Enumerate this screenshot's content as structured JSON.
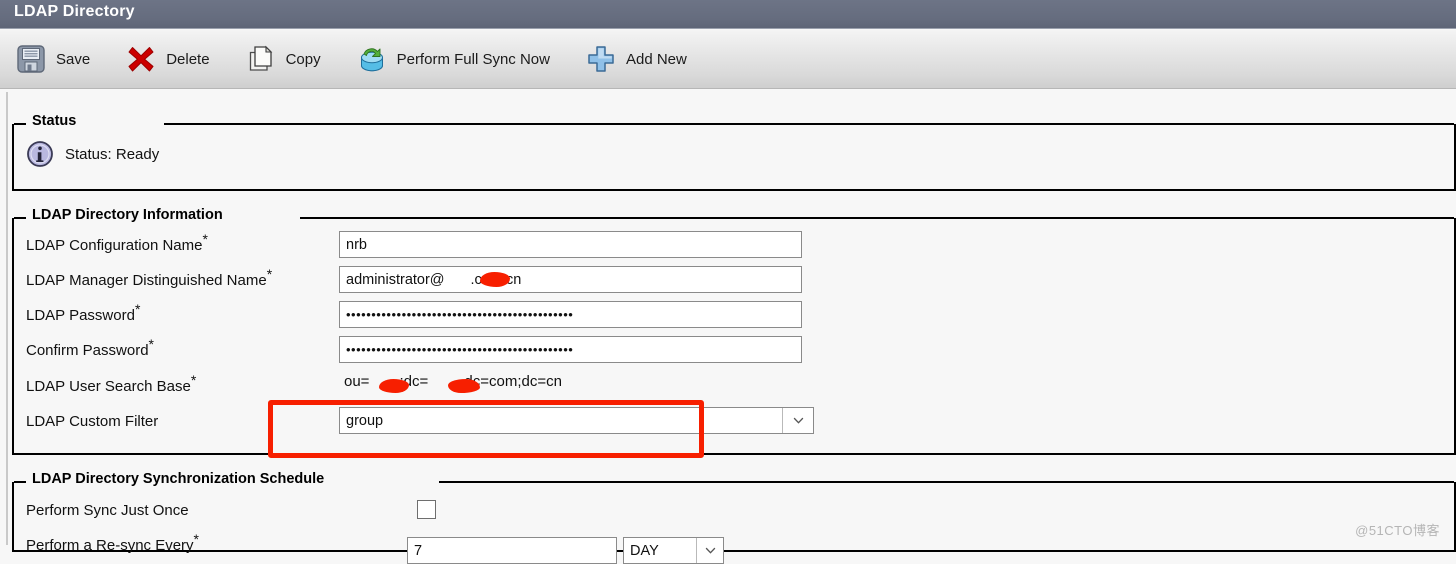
{
  "window": {
    "title": "LDAP Directory"
  },
  "toolbar": {
    "items": [
      {
        "label": "Save",
        "icon": "floppy-disk-icon",
        "name": "save"
      },
      {
        "label": "Delete",
        "icon": "red-x-icon",
        "name": "delete"
      },
      {
        "label": "Copy",
        "icon": "copy-pages-icon",
        "name": "copy"
      },
      {
        "label": "Perform Full Sync Now",
        "icon": "sync-database-icon",
        "name": "perform-full-sync-now"
      },
      {
        "label": "Add New",
        "icon": "blue-plus-icon",
        "name": "add-new"
      }
    ]
  },
  "status_panel": {
    "legend": "Status",
    "icon": "info-icon",
    "text": "Status: Ready"
  },
  "info_panel": {
    "legend": "LDAP Directory Information",
    "rows": [
      {
        "label": "LDAP Configuration Name",
        "required": "*",
        "type": "textbox",
        "value": "nrb",
        "placeholder": ""
      },
      {
        "label": "LDAP Manager Distinguished Name",
        "required": "*",
        "type": "textbox",
        "value": "administrator@",
        "value_suffix": ".com.cn",
        "redacted": true,
        "placeholder": ""
      },
      {
        "label": "LDAP Password",
        "required": "*",
        "type": "password",
        "value": "•••••••••••••••••••••••••••••••••••••••••••••",
        "placeholder": ""
      },
      {
        "label": "Confirm Password",
        "required": "*",
        "type": "password",
        "value": "•••••••••••••••••••••••••••••••••••••••••••••",
        "placeholder": ""
      },
      {
        "label": "LDAP User Search Base",
        "required": "*",
        "type": "text",
        "value_a": "ou=",
        "value_b": ";dc=",
        "value_c": ",dc=com;dc=cn",
        "redacted": true
      },
      {
        "label": "LDAP Custom Filter",
        "required": "",
        "type": "select",
        "value": "group",
        "icon": "chevron-down-icon"
      }
    ]
  },
  "schedule_panel": {
    "legend": "LDAP Directory Synchronization Schedule",
    "rows": [
      {
        "label": "Perform Sync Just Once",
        "required": "",
        "type": "checkbox",
        "checked": false
      },
      {
        "label": "Perform a Re-sync Every",
        "required": "*",
        "type": "textbox-with-unit",
        "value": "7",
        "unit": "DAY",
        "unit_icon": "chevron-down-icon"
      }
    ]
  },
  "watermark": {
    "text": "@51CTO博客"
  },
  "colors": {
    "titlebar": "#666d7f",
    "annotation": "#f71f00",
    "panel_bg": "#f7f7f7",
    "field_border": "#8a8a8a"
  }
}
